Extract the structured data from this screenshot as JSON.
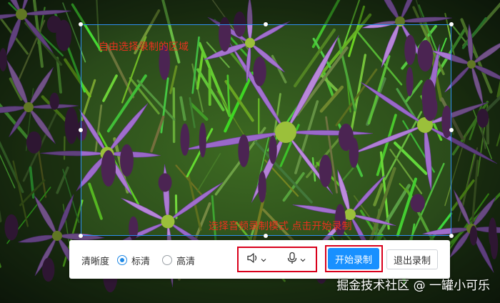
{
  "colors": {
    "selection_border": "#2f8ff0",
    "annotation_red": "#e8321e",
    "primary_button": "#1890ff",
    "radio_accent": "#1e88e5"
  },
  "annotations": {
    "top_left": "自由选择录制的区域",
    "bottom": "选择音频录制模式 点击开始录制"
  },
  "toolbar": {
    "quality_label": "清晰度",
    "options": [
      {
        "label": "标清",
        "selected": true
      },
      {
        "label": "高清",
        "selected": false
      }
    ],
    "speaker_icon": "speaker-icon",
    "mic_icon": "microphone-icon",
    "start_label": "开始录制",
    "exit_label": "退出录制"
  },
  "watermark": "掘金技术社区 @ 一罐小可乐"
}
